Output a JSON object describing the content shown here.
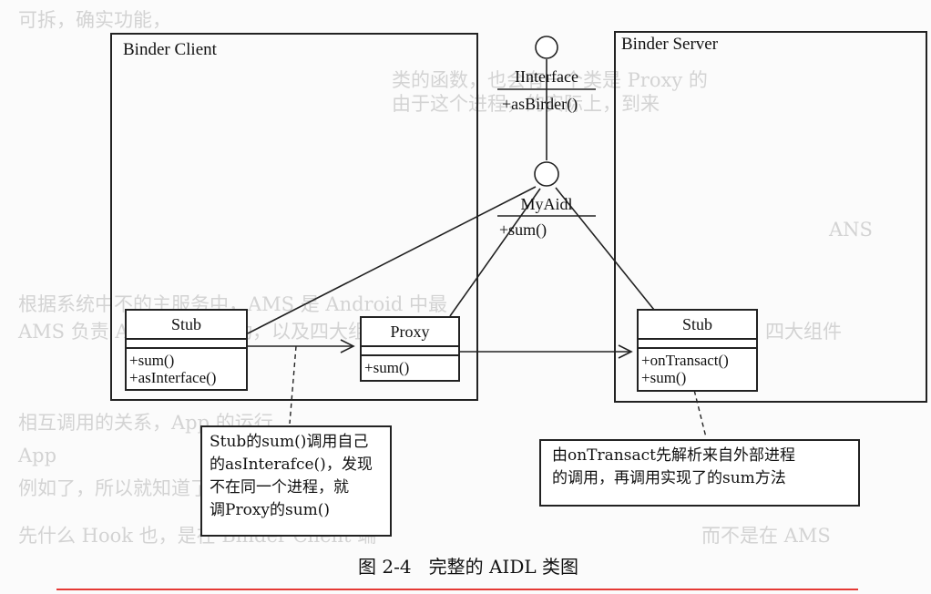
{
  "packages": {
    "client_title": "Binder Client",
    "server_title": "Binder Server"
  },
  "interfaces": {
    "iinterface": {
      "name": "IInterface",
      "method": "+asBirder()"
    },
    "myaidl": {
      "name": "MyAidl",
      "method": "+sum()"
    }
  },
  "classes": {
    "client_stub": {
      "name": "Stub",
      "methods": [
        "+sum()",
        "+asInterface()"
      ]
    },
    "proxy": {
      "name": "Proxy",
      "methods": [
        "+sum()"
      ]
    },
    "server_stub": {
      "name": "Stub",
      "methods": [
        "+onTransact()",
        "+sum()"
      ]
    }
  },
  "notes": {
    "client_note": [
      "Stub的sum()调用自己",
      "的asInterafce()，发现",
      "不在同一个进程，就",
      "调Proxy的sum()"
    ],
    "server_note": [
      "由onTransact先解析来自外部进程",
      "的调用，再调用实现了的sum方法"
    ]
  },
  "caption": "图 2-4   完整的 AIDL 类图",
  "colors": {
    "rule": "#e53935",
    "ink": "#222222",
    "bleed": "#d3d3d3"
  }
}
